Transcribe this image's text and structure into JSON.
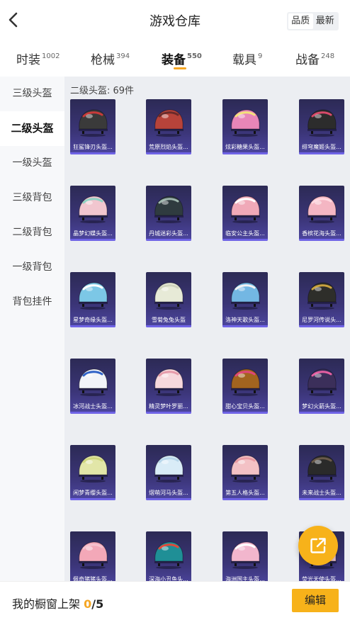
{
  "header": {
    "title": "游戏仓库",
    "sort_quality": "品质",
    "sort_newest": "最新"
  },
  "tabs": [
    {
      "label": "时装",
      "count": "1002"
    },
    {
      "label": "枪械",
      "count": "394"
    },
    {
      "label": "装备",
      "count": "550"
    },
    {
      "label": "载具",
      "count": "9"
    },
    {
      "label": "战备",
      "count": "248"
    }
  ],
  "sidebar": {
    "items": [
      "三级头盔",
      "二级头盔",
      "一级头盔",
      "三级背包",
      "二级背包",
      "一级背包",
      "背包挂件"
    ]
  },
  "section": {
    "title": "二级头盔: 69件"
  },
  "items": [
    {
      "name": "狂鲨锋刃头盔...",
      "color": "#3a3a3a",
      "accent": "#c93a3a"
    },
    {
      "name": "荒原烈焰头盔...",
      "color": "#b8433a",
      "accent": "#6a2a2a"
    },
    {
      "name": "炫彩糖果头盔...",
      "color": "#e886b8",
      "accent": "#f2e27a"
    },
    {
      "name": "绯穹魔姬头盔...",
      "color": "#2c2c2c",
      "accent": "#d84a6a"
    },
    {
      "name": "晶梦幻蝶头盔...",
      "color": "#f1c6cf",
      "accent": "#8fd3c3"
    },
    {
      "name": "丹城迷彩头盔...",
      "color": "#2f3b3f",
      "accent": "#9fb6ad"
    },
    {
      "name": "临安公主头盔...",
      "color": "#f0a9b8",
      "accent": "#ffffff"
    },
    {
      "name": "香槟花海头盔...",
      "color": "#f4b6c3",
      "accent": "#ffd8e0"
    },
    {
      "name": "星梦奇缘头盔...",
      "color": "#7cc7e6",
      "accent": "#ffffff"
    },
    {
      "name": "雪菊兔兔头盔",
      "color": "#e7ead7",
      "accent": "#cfd3bd"
    },
    {
      "name": "洛神天歌头盔...",
      "color": "#73b7e3",
      "accent": "#f2f2f2"
    },
    {
      "name": "尼罗河传说头...",
      "color": "#2e2e2a",
      "accent": "#c9a23f"
    },
    {
      "name": "冰河战士头盔...",
      "color": "#f2f4f8",
      "accent": "#2f62c7"
    },
    {
      "name": "精灵梦叶罗丽...",
      "color": "#f6d8dc",
      "accent": "#e59aa9"
    },
    {
      "name": "甜心宝贝头盔...",
      "color": "#a2641f",
      "accent": "#e0457a"
    },
    {
      "name": "梦幻火箭头盔...",
      "color": "#3b2f5a",
      "accent": "#e65fa2"
    },
    {
      "name": "闲梦青缨头盔...",
      "color": "#e2e6a8",
      "accent": "#cfd67c"
    },
    {
      "name": "熠萌河马头盔...",
      "color": "#d9ecf7",
      "accent": "#b7d6ea"
    },
    {
      "name": "第五人格头盔...",
      "color": "#f3c1c5",
      "accent": "#e89aa2"
    },
    {
      "name": "未来战士头盔...",
      "color": "#2a2a2a",
      "accent": "#6a5a4a"
    },
    {
      "name": "佩奇猪猪头盔...",
      "color": "#f3a8b8",
      "accent": "#f6c2ce"
    },
    {
      "name": "深海小丑鱼头...",
      "color": "#1f8f96",
      "accent": "#e04a3a"
    },
    {
      "name": "海洲国主头盔...",
      "color": "#f2b6cd",
      "accent": "#ffffff"
    },
    {
      "name": "荧光天使头盔...",
      "color": "#f3c8d6",
      "accent": "#ffffff"
    }
  ],
  "bottom": {
    "label": "我的橱窗上架",
    "count": "0",
    "total": "/5",
    "edit": "编辑"
  }
}
